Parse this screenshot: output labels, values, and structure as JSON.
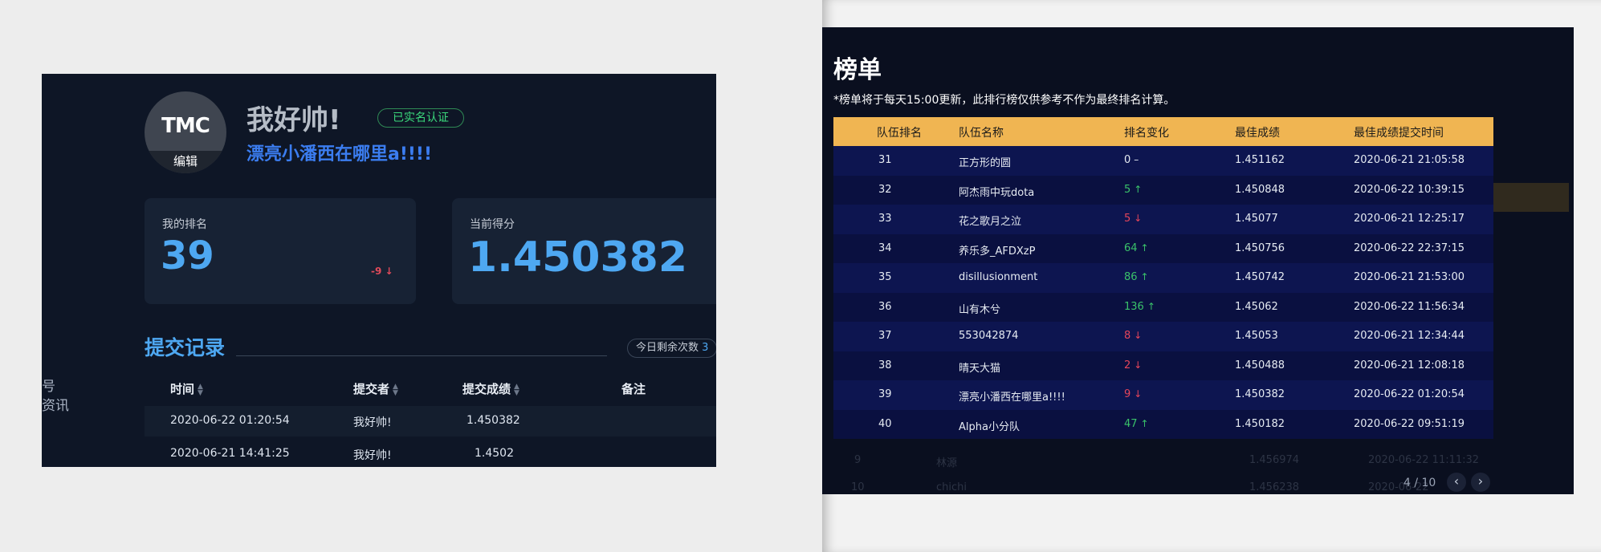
{
  "left": {
    "sidebar_fragments": [
      "号",
      "资讯"
    ],
    "avatar_logo": "TMC",
    "avatar_edit": "编辑",
    "nickname": "我好帅!",
    "verify_badge": "已实名认证",
    "team_name": "漂亮小潘西在哪里a!!!!",
    "rank_card": {
      "label": "我的排名",
      "value": "39",
      "delta": "-9"
    },
    "score_card": {
      "label": "当前得分",
      "value": "1.450382"
    },
    "submissions": {
      "title": "提交记录",
      "remaining_label": "今日剩余次数",
      "remaining_value": "3",
      "columns": [
        "时间",
        "提交者",
        "提交成绩",
        "备注"
      ],
      "rows": [
        [
          "2020-06-22 01:20:54",
          "我好帅!",
          "1.450382",
          ""
        ],
        [
          "2020-06-21 14:41:25",
          "我好帅!",
          "1.4502",
          ""
        ]
      ]
    }
  },
  "right": {
    "title": "榜单",
    "note": "*榜单将于每天15:00更新，此排行榜仅供参考不作为最终排名计算。",
    "columns": [
      "队伍排名",
      "队伍名称",
      "排名变化",
      "最佳成绩",
      "最佳成绩提交时间"
    ],
    "rows": [
      {
        "rank": "31",
        "name": "正方形的圆",
        "change": "0",
        "dir": "none",
        "score": "1.451162",
        "time": "2020-06-21 21:05:58"
      },
      {
        "rank": "32",
        "name": "阿杰雨中玩dota",
        "change": "5",
        "dir": "up",
        "score": "1.450848",
        "time": "2020-06-22 10:39:15"
      },
      {
        "rank": "33",
        "name": "花之歌月之泣",
        "change": "5",
        "dir": "down",
        "score": "1.45077",
        "time": "2020-06-21 12:25:17"
      },
      {
        "rank": "34",
        "name": "养乐多_AFDXzP",
        "change": "64",
        "dir": "up",
        "score": "1.450756",
        "time": "2020-06-22 22:37:15"
      },
      {
        "rank": "35",
        "name": "disillusionment",
        "change": "86",
        "dir": "up",
        "score": "1.450742",
        "time": "2020-06-21 21:53:00"
      },
      {
        "rank": "36",
        "name": "山有木兮",
        "change": "136",
        "dir": "up",
        "score": "1.45062",
        "time": "2020-06-22 11:56:34"
      },
      {
        "rank": "37",
        "name": "553042874",
        "change": "8",
        "dir": "down",
        "score": "1.45053",
        "time": "2020-06-21 12:34:44"
      },
      {
        "rank": "38",
        "name": "晴天大猫",
        "change": "2",
        "dir": "down",
        "score": "1.450488",
        "time": "2020-06-21 12:08:18"
      },
      {
        "rank": "39",
        "name": "漂亮小潘西在哪里a!!!!",
        "change": "9",
        "dir": "down",
        "score": "1.450382",
        "time": "2020-06-22 01:20:54"
      },
      {
        "rank": "40",
        "name": "Alpha小分队",
        "change": "47",
        "dir": "up",
        "score": "1.450182",
        "time": "2020-06-22 09:51:19"
      }
    ],
    "ghost_rows": [
      {
        "rank": "9",
        "name": "林源",
        "score": "1.456974",
        "time": "2020-06-22 11:11:32"
      },
      {
        "rank": "10",
        "name": "chichi",
        "score": "1.456238",
        "time": "2020-06-22"
      }
    ],
    "pager": "4 / 10"
  },
  "colors": {
    "accent_blue": "#4ea8f2",
    "header_gold": "#f0b552",
    "up_green": "#3ac26a",
    "down_red": "#e5455a",
    "verify_green": "#3bd97c"
  }
}
